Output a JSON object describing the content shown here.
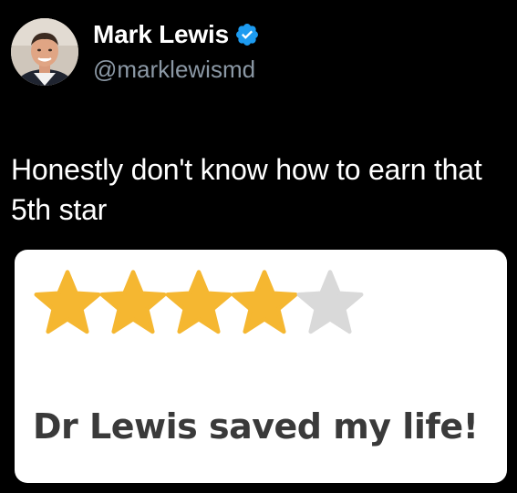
{
  "tweet": {
    "author": {
      "display_name": "Mark Lewis",
      "handle": "@marklewismd",
      "verified": true,
      "avatar_icon": "profile-photo"
    },
    "text": "Honestly don't know how to earn that 5th star"
  },
  "review_card": {
    "rating": 4,
    "max_rating": 5,
    "star_filled_color": "#f5b731",
    "star_empty_color": "#d9d9d9",
    "text": "Dr Lewis saved my life!"
  },
  "colors": {
    "background": "#000000",
    "handle": "#8b98a5",
    "verified_badge": "#1d9bf0"
  }
}
